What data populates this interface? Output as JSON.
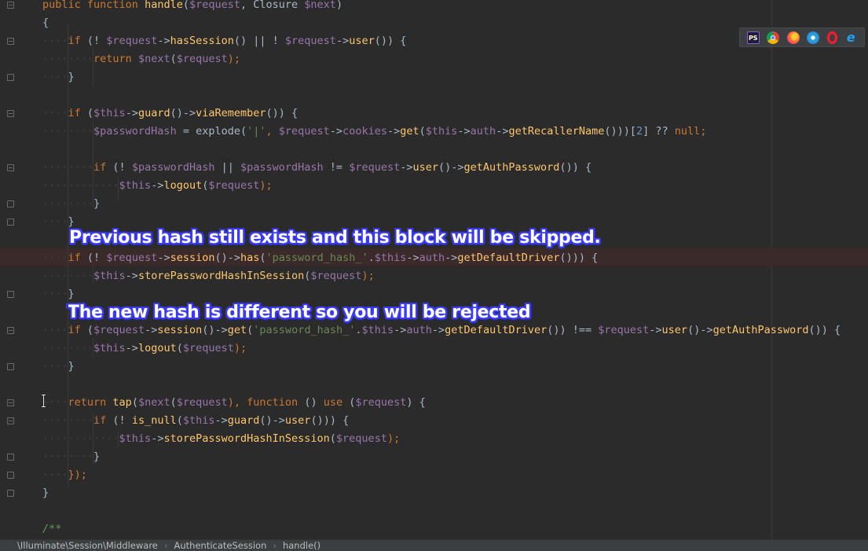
{
  "editor": {
    "lines": [
      {
        "tokens": [
          {
            "t": "public ",
            "c": "k"
          },
          {
            "t": "function ",
            "c": "k"
          },
          {
            "t": "handle",
            "c": "f"
          },
          {
            "t": "(",
            "c": "p"
          },
          {
            "t": "$request",
            "c": "v"
          },
          {
            "t": ", Closure ",
            "c": "p"
          },
          {
            "t": "$next",
            "c": "v"
          },
          {
            "t": ")",
            "c": "p"
          }
        ]
      },
      {
        "tokens": [
          {
            "t": "{",
            "c": "p"
          }
        ]
      },
      {
        "tokens": [
          {
            "t": "    "
          },
          {
            "t": "if ",
            "c": "k"
          },
          {
            "t": "(! ",
            "c": "p"
          },
          {
            "t": "$request",
            "c": "v"
          },
          {
            "t": "->",
            "c": "p"
          },
          {
            "t": "hasSession",
            "c": "m"
          },
          {
            "t": "() || ! ",
            "c": "p"
          },
          {
            "t": "$request",
            "c": "v"
          },
          {
            "t": "->",
            "c": "p"
          },
          {
            "t": "user",
            "c": "m"
          },
          {
            "t": "()) {",
            "c": "p"
          }
        ]
      },
      {
        "tokens": [
          {
            "t": "        "
          },
          {
            "t": "return ",
            "c": "k"
          },
          {
            "t": "$next",
            "c": "v"
          },
          {
            "t": "(",
            "c": "p"
          },
          {
            "t": "$request",
            "c": "v"
          },
          {
            "t": ");",
            "c": "k"
          }
        ]
      },
      {
        "tokens": [
          {
            "t": "    "
          },
          {
            "t": "}",
            "c": "p"
          }
        ]
      },
      {
        "tokens": []
      },
      {
        "tokens": [
          {
            "t": "    "
          },
          {
            "t": "if ",
            "c": "k"
          },
          {
            "t": "(",
            "c": "p"
          },
          {
            "t": "$this",
            "c": "v"
          },
          {
            "t": "->",
            "c": "p"
          },
          {
            "t": "guard",
            "c": "m"
          },
          {
            "t": "()->",
            "c": "p"
          },
          {
            "t": "viaRemember",
            "c": "m"
          },
          {
            "t": "()) {",
            "c": "p"
          }
        ]
      },
      {
        "tokens": [
          {
            "t": "        "
          },
          {
            "t": "$passwordHash",
            "c": "v"
          },
          {
            "t": " = explode(",
            "c": "p"
          },
          {
            "t": "'|'",
            "c": "s"
          },
          {
            "t": ", ",
            "c": "k"
          },
          {
            "t": "$request",
            "c": "v"
          },
          {
            "t": "->",
            "c": "p"
          },
          {
            "t": "cookies",
            "c": "v"
          },
          {
            "t": "->",
            "c": "p"
          },
          {
            "t": "get",
            "c": "m"
          },
          {
            "t": "(",
            "c": "p"
          },
          {
            "t": "$this",
            "c": "v"
          },
          {
            "t": "->",
            "c": "p"
          },
          {
            "t": "auth",
            "c": "v"
          },
          {
            "t": "->",
            "c": "p"
          },
          {
            "t": "getRecallerName",
            "c": "m"
          },
          {
            "t": "()))[",
            "c": "p"
          },
          {
            "t": "2",
            "c": "n"
          },
          {
            "t": "] ?? ",
            "c": "p"
          },
          {
            "t": "null",
            "c": "k"
          },
          {
            "t": ";",
            "c": "k"
          }
        ]
      },
      {
        "tokens": []
      },
      {
        "tokens": [
          {
            "t": "        "
          },
          {
            "t": "if ",
            "c": "k"
          },
          {
            "t": "(! ",
            "c": "p"
          },
          {
            "t": "$passwordHash",
            "c": "v"
          },
          {
            "t": " || ",
            "c": "p"
          },
          {
            "t": "$passwordHash",
            "c": "v"
          },
          {
            "t": " != ",
            "c": "p"
          },
          {
            "t": "$request",
            "c": "v"
          },
          {
            "t": "->",
            "c": "p"
          },
          {
            "t": "user",
            "c": "m"
          },
          {
            "t": "()->",
            "c": "p"
          },
          {
            "t": "getAuthPassword",
            "c": "m"
          },
          {
            "t": "()) {",
            "c": "p"
          }
        ]
      },
      {
        "tokens": [
          {
            "t": "            "
          },
          {
            "t": "$this",
            "c": "v"
          },
          {
            "t": "->",
            "c": "p"
          },
          {
            "t": "logout",
            "c": "m"
          },
          {
            "t": "(",
            "c": "p"
          },
          {
            "t": "$request",
            "c": "v"
          },
          {
            "t": ");",
            "c": "k"
          }
        ]
      },
      {
        "tokens": [
          {
            "t": "        "
          },
          {
            "t": "}",
            "c": "p"
          }
        ]
      },
      {
        "tokens": [
          {
            "t": "    "
          },
          {
            "t": "}",
            "c": "p"
          }
        ]
      },
      {
        "tokens": []
      },
      {
        "tokens": [
          {
            "t": "    "
          },
          {
            "t": "if ",
            "c": "k"
          },
          {
            "t": "(! ",
            "c": "p"
          },
          {
            "t": "$request",
            "c": "v"
          },
          {
            "t": "->",
            "c": "p"
          },
          {
            "t": "session",
            "c": "m"
          },
          {
            "t": "()->",
            "c": "p"
          },
          {
            "t": "has",
            "c": "m"
          },
          {
            "t": "(",
            "c": "p"
          },
          {
            "t": "'password_hash_'",
            "c": "s"
          },
          {
            "t": ".",
            "c": "p"
          },
          {
            "t": "$this",
            "c": "v"
          },
          {
            "t": "->",
            "c": "p"
          },
          {
            "t": "auth",
            "c": "v"
          },
          {
            "t": "->",
            "c": "p"
          },
          {
            "t": "getDefaultDriver",
            "c": "m"
          },
          {
            "t": "())) {",
            "c": "p"
          }
        ]
      },
      {
        "tokens": [
          {
            "t": "        "
          },
          {
            "t": "$this",
            "c": "v"
          },
          {
            "t": "->",
            "c": "p"
          },
          {
            "t": "storePasswordHashInSession",
            "c": "m"
          },
          {
            "t": "(",
            "c": "p"
          },
          {
            "t": "$request",
            "c": "v"
          },
          {
            "t": ");",
            "c": "k"
          }
        ]
      },
      {
        "tokens": [
          {
            "t": "    "
          },
          {
            "t": "}",
            "c": "p"
          }
        ]
      },
      {
        "tokens": []
      },
      {
        "tokens": [
          {
            "t": "    "
          },
          {
            "t": "if ",
            "c": "k"
          },
          {
            "t": "(",
            "c": "p"
          },
          {
            "t": "$request",
            "c": "v"
          },
          {
            "t": "->",
            "c": "p"
          },
          {
            "t": "session",
            "c": "m"
          },
          {
            "t": "()->",
            "c": "p"
          },
          {
            "t": "get",
            "c": "m"
          },
          {
            "t": "(",
            "c": "p"
          },
          {
            "t": "'password_hash_'",
            "c": "s"
          },
          {
            "t": ".",
            "c": "p"
          },
          {
            "t": "$this",
            "c": "v"
          },
          {
            "t": "->",
            "c": "p"
          },
          {
            "t": "auth",
            "c": "v"
          },
          {
            "t": "->",
            "c": "p"
          },
          {
            "t": "getDefaultDriver",
            "c": "m"
          },
          {
            "t": "()) !== ",
            "c": "p"
          },
          {
            "t": "$request",
            "c": "v"
          },
          {
            "t": "->",
            "c": "p"
          },
          {
            "t": "user",
            "c": "m"
          },
          {
            "t": "()->",
            "c": "p"
          },
          {
            "t": "getAuthPassword",
            "c": "m"
          },
          {
            "t": "()) {",
            "c": "p"
          }
        ]
      },
      {
        "tokens": [
          {
            "t": "        "
          },
          {
            "t": "$this",
            "c": "v"
          },
          {
            "t": "->",
            "c": "p"
          },
          {
            "t": "logout",
            "c": "m"
          },
          {
            "t": "(",
            "c": "p"
          },
          {
            "t": "$request",
            "c": "v"
          },
          {
            "t": ");",
            "c": "k"
          }
        ]
      },
      {
        "tokens": [
          {
            "t": "    "
          },
          {
            "t": "}",
            "c": "p"
          }
        ]
      },
      {
        "tokens": []
      },
      {
        "tokens": [
          {
            "t": "    "
          },
          {
            "t": "return ",
            "c": "k"
          },
          {
            "t": "tap",
            "c": "m"
          },
          {
            "t": "(",
            "c": "p"
          },
          {
            "t": "$next",
            "c": "v"
          },
          {
            "t": "(",
            "c": "p"
          },
          {
            "t": "$request",
            "c": "v"
          },
          {
            "t": "), ",
            "c": "k"
          },
          {
            "t": "function ",
            "c": "k"
          },
          {
            "t": "() ",
            "c": "p"
          },
          {
            "t": "use ",
            "c": "k"
          },
          {
            "t": "(",
            "c": "p"
          },
          {
            "t": "$request",
            "c": "v"
          },
          {
            "t": ") {",
            "c": "p"
          }
        ]
      },
      {
        "tokens": [
          {
            "t": "        "
          },
          {
            "t": "if ",
            "c": "k"
          },
          {
            "t": "(! ",
            "c": "p"
          },
          {
            "t": "is_null",
            "c": "m"
          },
          {
            "t": "(",
            "c": "p"
          },
          {
            "t": "$this",
            "c": "v"
          },
          {
            "t": "->",
            "c": "p"
          },
          {
            "t": "guard",
            "c": "m"
          },
          {
            "t": "()->",
            "c": "p"
          },
          {
            "t": "user",
            "c": "m"
          },
          {
            "t": "())) {",
            "c": "p"
          }
        ]
      },
      {
        "tokens": [
          {
            "t": "            "
          },
          {
            "t": "$this",
            "c": "v"
          },
          {
            "t": "->",
            "c": "p"
          },
          {
            "t": "storePasswordHashInSession",
            "c": "m"
          },
          {
            "t": "(",
            "c": "p"
          },
          {
            "t": "$request",
            "c": "v"
          },
          {
            "t": ");",
            "c": "k"
          }
        ]
      },
      {
        "tokens": [
          {
            "t": "        "
          },
          {
            "t": "}",
            "c": "p"
          }
        ]
      },
      {
        "tokens": [
          {
            "t": "    "
          },
          {
            "t": "});",
            "c": "k"
          }
        ]
      },
      {
        "tokens": [
          {
            "t": "}",
            "c": "p"
          }
        ]
      },
      {
        "tokens": []
      },
      {
        "tokens": [
          {
            "t": "/**",
            "c": "c"
          }
        ]
      }
    ]
  },
  "annotations": {
    "first": "Previous hash still exists and this block will be skipped.",
    "second": "The new hash is different so you will be rejected"
  },
  "browser_icons": [
    "phpstorm-icon",
    "chrome-icon",
    "firefox-icon",
    "safari-icon",
    "opera-icon",
    "ie-icon"
  ],
  "breadcrumb": {
    "items": [
      "\\Illuminate\\Session\\Middleware",
      "AuthenticateSession",
      "handle()"
    ]
  },
  "colors": {
    "background": "#2b2b2b",
    "keyword": "#cc7832",
    "variable": "#9876aa",
    "method": "#ffc66d",
    "string": "#6a8759",
    "number": "#6897bb",
    "annotation_outline": "#3a3aff"
  }
}
